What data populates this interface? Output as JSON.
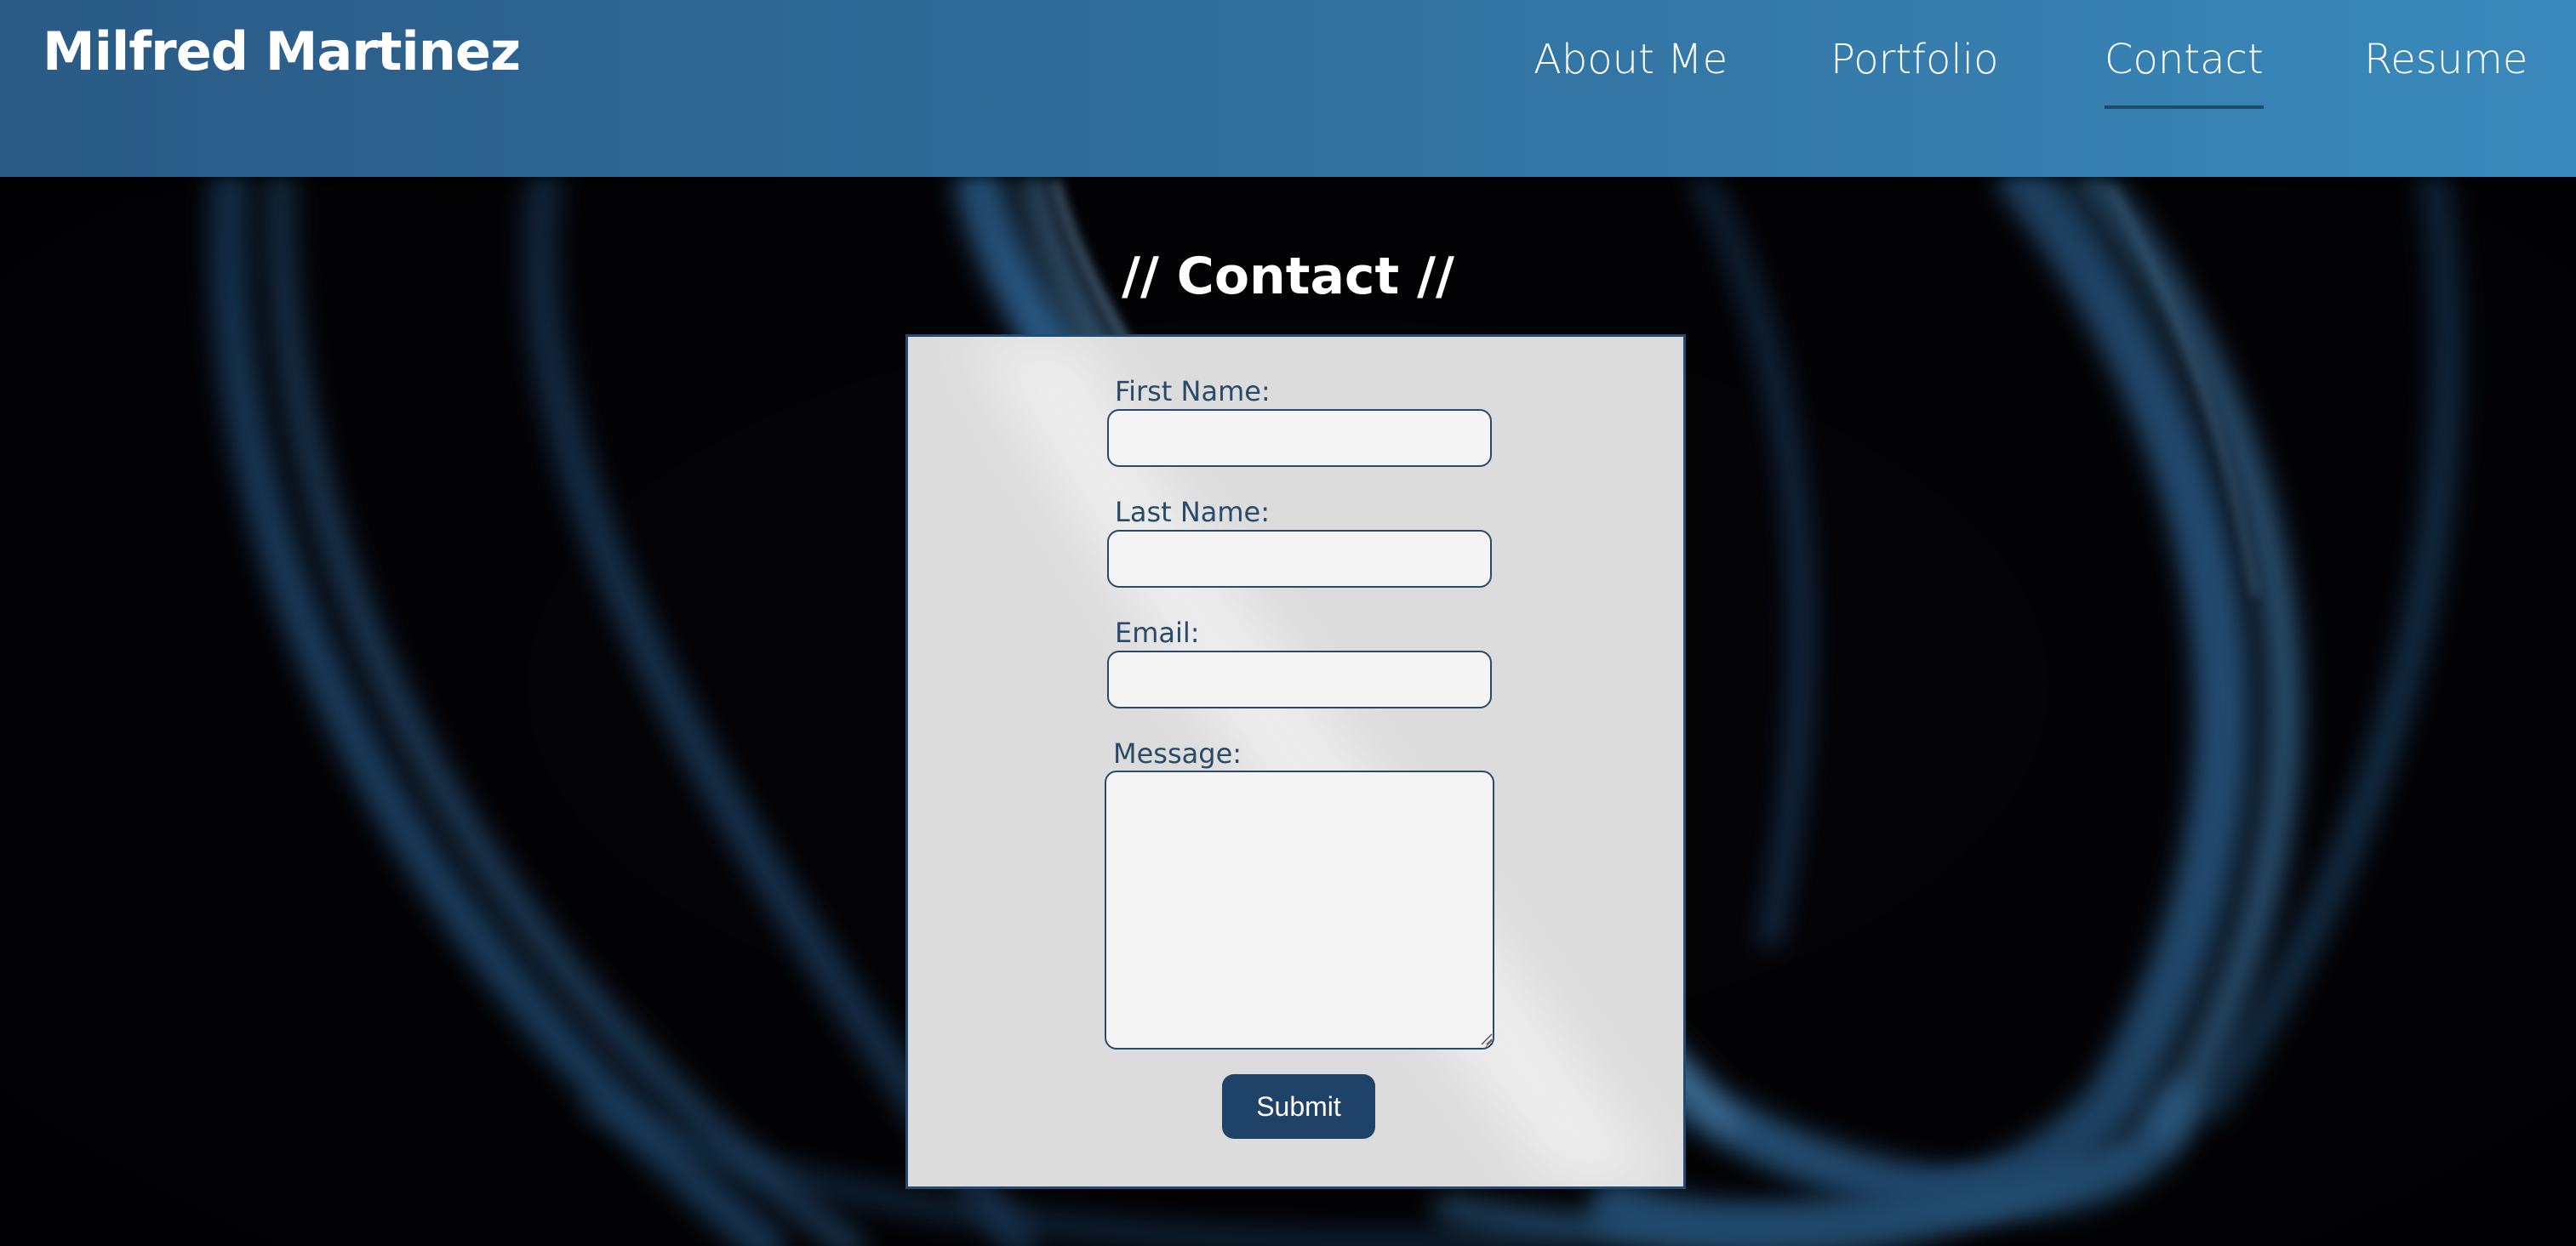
{
  "site": {
    "title": "Milfred Martinez"
  },
  "nav": {
    "items": [
      {
        "label": "About Me",
        "active": false
      },
      {
        "label": "Portfolio",
        "active": false
      },
      {
        "label": "Contact",
        "active": true
      },
      {
        "label": "Resume",
        "active": false
      }
    ]
  },
  "page": {
    "heading": "// Contact //"
  },
  "form": {
    "first_name_label": "First Name:",
    "first_name_value": "",
    "last_name_label": "Last Name:",
    "last_name_value": "",
    "email_label": "Email:",
    "email_value": "",
    "message_label": "Message:",
    "message_value": "",
    "submit_label": "Submit"
  },
  "colors": {
    "header_start": "#2a5a86",
    "header_end": "#3a89bc",
    "form_border": "#234a70",
    "form_bg": "#dcdcdc",
    "label_text": "#2a4a6a",
    "button_bg": "#1f4268",
    "background": "#030306",
    "light_trail": "#3d86c6"
  }
}
